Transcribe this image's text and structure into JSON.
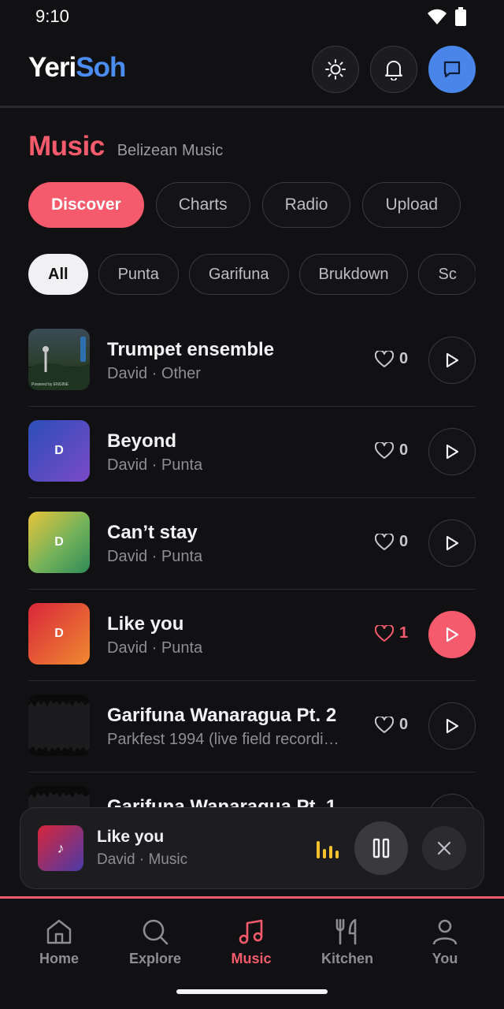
{
  "status_bar": {
    "time": "9:10"
  },
  "header": {
    "logo_part1": "Yeri",
    "logo_part2": "Soh",
    "buttons": [
      "theme-toggle",
      "notifications",
      "messages"
    ]
  },
  "section": {
    "title": "Music",
    "subtitle": "Belizean Music"
  },
  "tabs": [
    {
      "label": "Discover",
      "active": true
    },
    {
      "label": "Charts",
      "active": false
    },
    {
      "label": "Radio",
      "active": false
    },
    {
      "label": "Upload",
      "active": false
    }
  ],
  "chips": [
    {
      "label": "All",
      "active": true
    },
    {
      "label": "Punta",
      "active": false
    },
    {
      "label": "Garifuna",
      "active": false
    },
    {
      "label": "Brukdown",
      "active": false
    },
    {
      "label": "Sc",
      "active": false
    }
  ],
  "tracks": [
    {
      "title": "Trumpet ensemble",
      "subtitle": "David · Other",
      "likes": "0",
      "liked": false,
      "cover_text": "",
      "cover_style": "photo",
      "cover_caption": "Powered by ENGINE"
    },
    {
      "title": "Beyond",
      "subtitle": "David · Punta",
      "likes": "0",
      "liked": false,
      "cover_text": "D",
      "cover_style": "blue"
    },
    {
      "title": "Can’t stay",
      "subtitle": "David · Punta",
      "likes": "0",
      "liked": false,
      "cover_text": "D",
      "cover_style": "yellow"
    },
    {
      "title": "Like you",
      "subtitle": "David · Punta",
      "likes": "1",
      "liked": true,
      "cover_text": "D",
      "cover_style": "red"
    },
    {
      "title": "Garifuna Wanaragua Pt. 2",
      "subtitle": "Parkfest 1994 (live field recordi…",
      "likes": "0",
      "liked": false,
      "cover_text": "",
      "cover_style": "wave"
    },
    {
      "title": "Garifuna Wanaragua Pt. 1",
      "subtitle": "",
      "likes": "",
      "liked": false,
      "cover_text": "",
      "cover_style": "wave"
    }
  ],
  "player": {
    "title": "Like you",
    "subtitle": "David · Music",
    "cover_glyph": "♪",
    "state": "playing"
  },
  "nav": [
    {
      "label": "Home",
      "icon": "home-icon",
      "active": false
    },
    {
      "label": "Explore",
      "icon": "search-icon",
      "active": false
    },
    {
      "label": "Music",
      "icon": "music-note-icon",
      "active": true
    },
    {
      "label": "Kitchen",
      "icon": "fork-knife-icon",
      "active": false
    },
    {
      "label": "You",
      "icon": "user-icon",
      "active": false
    }
  ],
  "colors": {
    "accent": "#f55b6c",
    "brand_blue": "#4a8cf0",
    "equalizer": "#f4c22c",
    "background": "#111113"
  }
}
